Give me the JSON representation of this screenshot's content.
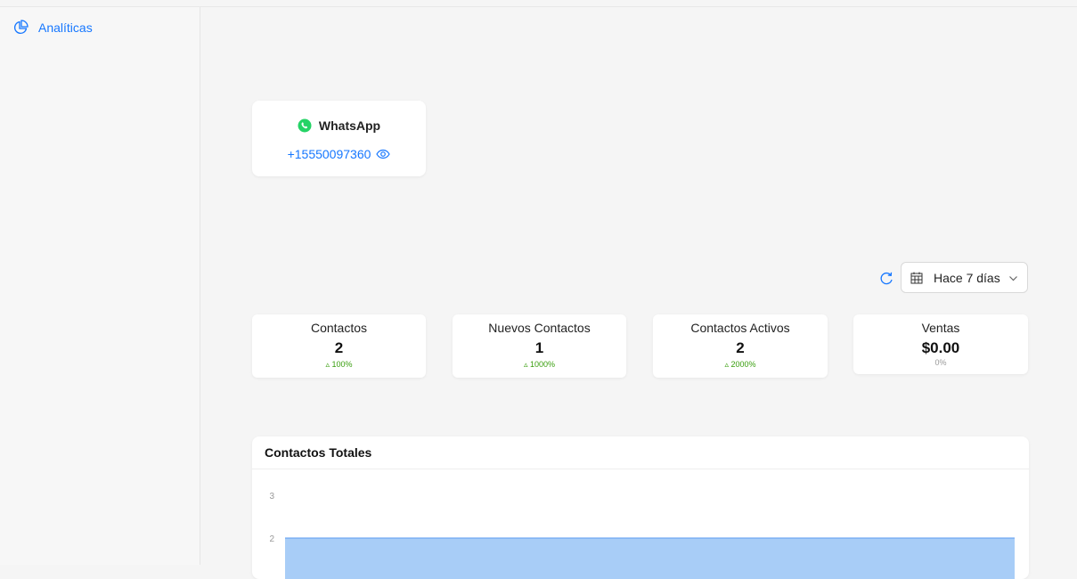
{
  "sidebar": {
    "items": [
      {
        "label": "Analíticas",
        "icon": "pie-chart-icon"
      }
    ]
  },
  "channel": {
    "name": "WhatsApp",
    "phone": "+15550097360",
    "brand_color": "#25d366"
  },
  "filters": {
    "range_label": "Hace 7 días"
  },
  "stats": [
    {
      "label": "Contactos",
      "value": "2",
      "delta": "100%",
      "trend": "up"
    },
    {
      "label": "Nuevos Contactos",
      "value": "1",
      "delta": "1000%",
      "trend": "up"
    },
    {
      "label": "Contactos Activos",
      "value": "2",
      "delta": "2000%",
      "trend": "up"
    },
    {
      "label": "Ventas",
      "value": "$0.00",
      "delta": "0%",
      "trend": "none"
    }
  ],
  "chart": {
    "title": "Contactos Totales",
    "chart_data": {
      "type": "area",
      "title": "Contactos Totales",
      "yticks": [
        "3",
        "2"
      ],
      "ylim": [
        0,
        3
      ],
      "series": [
        {
          "values": [
            2,
            2
          ]
        }
      ],
      "color": "#a8cdf7",
      "line_color": "#5b9bf0"
    }
  }
}
